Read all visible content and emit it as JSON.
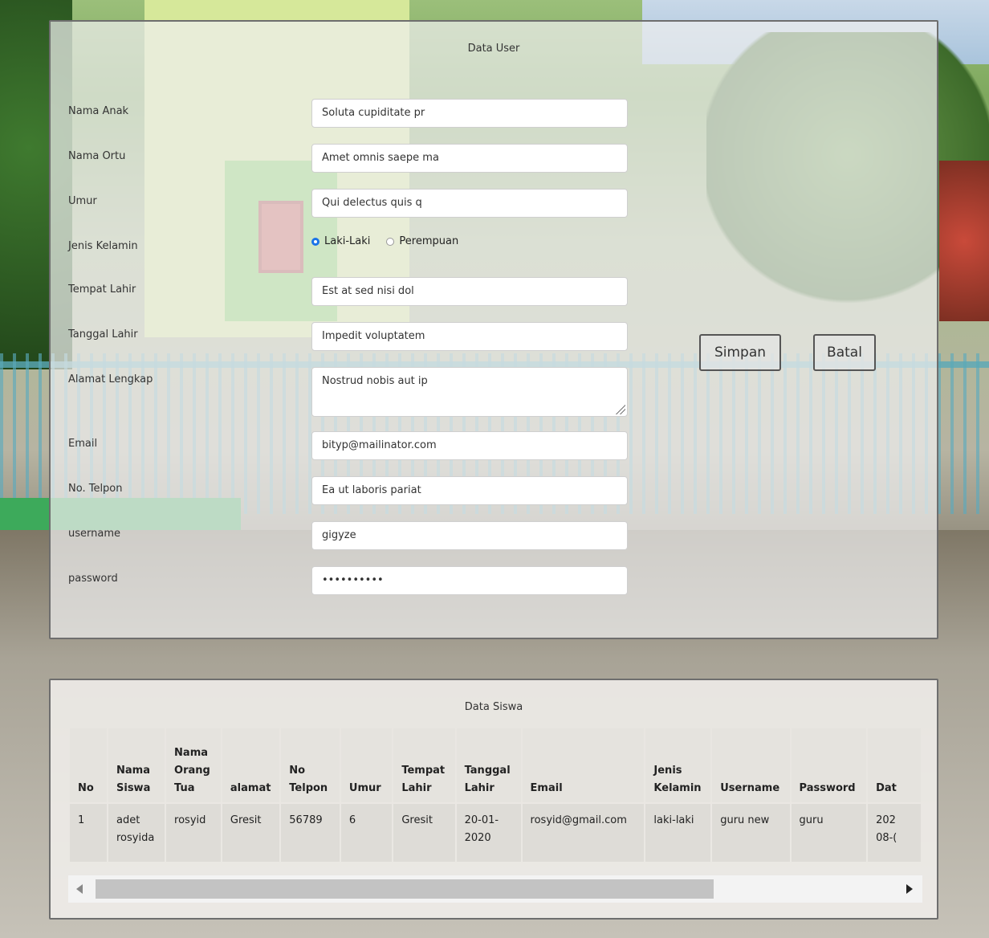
{
  "form": {
    "title": "Data User",
    "labels": {
      "nama_anak": "Nama Anak",
      "nama_ortu": "Nama Ortu",
      "umur": "Umur",
      "jenis_kelamin": "Jenis Kelamin",
      "tempat_lahir": "Tempat Lahir",
      "tanggal_lahir": "Tanggal Lahir",
      "alamat_lengkap": "Alamat Lengkap",
      "email": "Email",
      "no_telpon": "No. Telpon",
      "username": "username",
      "password": "password"
    },
    "values": {
      "nama_anak": "Soluta cupiditate pr",
      "nama_ortu": "Amet omnis saepe ma",
      "umur": "Qui delectus quis q",
      "tempat_lahir": "Est at sed nisi dol",
      "tanggal_lahir": "Impedit voluptatem",
      "alamat_lengkap": "Nostrud nobis aut ip",
      "email": "bityp@mailinator.com",
      "no_telpon": "Ea ut laboris pariat",
      "username": "gigyze",
      "password": "••••••••••"
    },
    "gender": {
      "options": [
        "Laki-Laki",
        "Perempuan"
      ],
      "selected": "Laki-Laki"
    },
    "buttons": {
      "save": "Simpan",
      "cancel": "Batal"
    }
  },
  "table": {
    "title": "Data Siswa",
    "headers": [
      "No",
      "Nama Siswa",
      "Nama Orang Tua",
      "alamat",
      "No Telpon",
      "Umur",
      "Tempat Lahir",
      "Tanggal Lahir",
      "Email",
      "Jenis Kelamin",
      "Username",
      "Password",
      "Dat"
    ],
    "rows": [
      [
        "1",
        "adet rosyida",
        "rosyid",
        "Gresit",
        "56789",
        "6",
        "Gresit",
        "20-01-2020",
        "rosyid@gmail.com",
        "laki-laki",
        "guru new",
        "guru",
        "202 08-("
      ]
    ]
  },
  "scroll": {
    "position_fraction": 0.0,
    "visible_fraction": 0.77
  }
}
